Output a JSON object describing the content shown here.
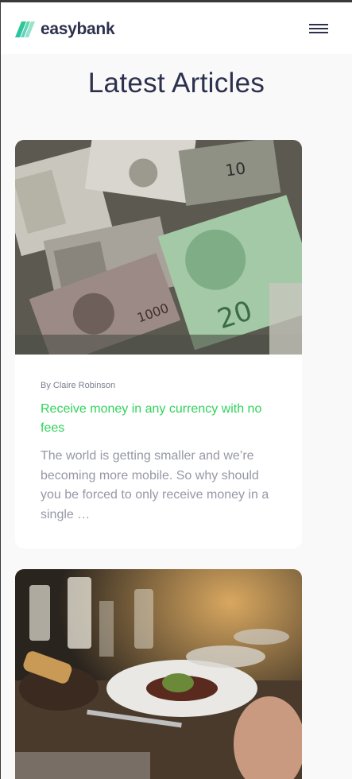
{
  "header": {
    "brand": "easybank",
    "logo_icon": "easybank-logo-icon",
    "menu_icon": "hamburger-menu-icon"
  },
  "section": {
    "title": "Latest Articles"
  },
  "articles": [
    {
      "image": "currency-banknotes-photo",
      "author": "By Claire Robinson",
      "title": "Receive money in any currency with no fees",
      "excerpt": "The world is getting smaller and we’re becoming more mobile. So why should you be forced to only receive money in a single …"
    },
    {
      "image": "restaurant-dinner-photo"
    }
  ],
  "colors": {
    "brand_dark": "#2d314d",
    "accent_green": "#31d35c",
    "text_grey": "#9698a6",
    "background": "#f9f9f9"
  }
}
